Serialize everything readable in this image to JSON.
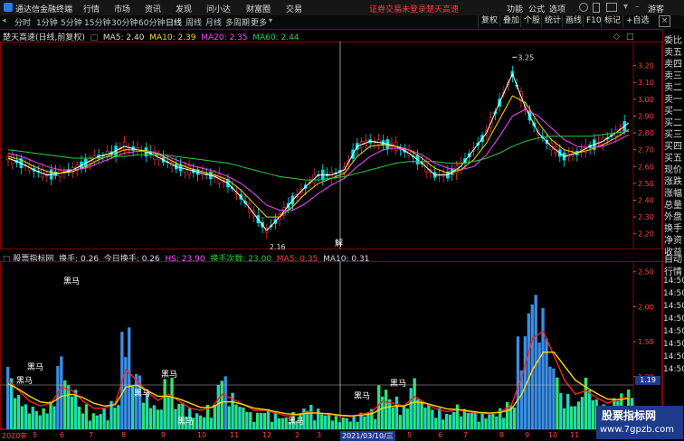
{
  "app": {
    "brand": "通达信金融终端",
    "menu": [
      "行情",
      "市场",
      "资讯",
      "发现",
      "问小达",
      "财富圈",
      "交易"
    ],
    "promo": "证券交易未登录",
    "stock_short": "楚天高速",
    "right_menu": [
      "功能",
      "公式",
      "选项"
    ],
    "guest": "游客"
  },
  "toolbar": {
    "periods": [
      "分时",
      "1分钟",
      "5分钟",
      "15分钟",
      "30分钟",
      "60分钟",
      "日线",
      "周线",
      "月线",
      "多周期",
      "更多"
    ],
    "active_period": "日线",
    "buttons": [
      "复权",
      "叠加",
      "个股",
      "统计",
      "画线",
      "F10",
      "标记",
      "+自选"
    ]
  },
  "main_chart": {
    "title": "楚天高速(日线,前复权)",
    "ma5": "MA5: 2.40",
    "ma10": "MA10: 2.39",
    "ma20": "MA20: 2.35",
    "ma60": "MA60: 2.44",
    "high_mark": "3.25",
    "low_mark": "2.16",
    "cursor_label": "解"
  },
  "sub_chart": {
    "title": "股票指标网",
    "turnover": "换手: 0.26",
    "today_turnover": "今日换手: 0.26",
    "hs": "HS: 23.90",
    "turnover_count": "换手次数: 23.00",
    "ma5": "MA5: 0.35",
    "ma10": "MA10: 0.31",
    "marker": "黑马",
    "cursor_value": "1.19"
  },
  "right_panel": {
    "items": [
      "委比",
      "卖五",
      "卖四",
      "卖三",
      "卖二",
      "卖一",
      "买一",
      "买二",
      "买三",
      "买四",
      "买五",
      "现价",
      "涨跌",
      "涨幅",
      "总量",
      "外盘",
      "换手",
      "净资",
      "收益"
    ],
    "lower": [
      "自动",
      "行情",
      "14:50",
      "14:50",
      "14:50",
      "14:50",
      "14:50",
      "14:50",
      "14:50",
      "14:50"
    ]
  },
  "watermark": {
    "line1": "股票指标网",
    "line2": "www.7gpzb.com"
  },
  "date_axis": {
    "start": "2020年",
    "ticks": [
      "5",
      "6",
      "7",
      "8",
      "9",
      "10",
      "11",
      "12",
      "2",
      "3"
    ],
    "cursor_date": "2021/03/10/三",
    "ticks_after": [
      "5",
      "6",
      "7",
      "8",
      "9",
      "10",
      "11"
    ]
  },
  "chart_data": [
    {
      "type": "line",
      "title": "楚天高速(日线,前复权)",
      "ylim": [
        2.15,
        3.3
      ],
      "yticks": [
        "3.20",
        "3.10",
        "3.00",
        "2.90",
        "2.80",
        "2.70",
        "2.60",
        "2.50",
        "2.40",
        "2.30",
        "2.20"
      ],
      "series": [
        {
          "name": "MA5",
          "color": "#ffffff",
          "values": [
            2.65,
            2.62,
            2.58,
            2.55,
            2.56,
            2.58,
            2.62,
            2.66,
            2.68,
            2.72,
            2.7,
            2.68,
            2.64,
            2.6,
            2.58,
            2.56,
            2.54,
            2.5,
            2.42,
            2.32,
            2.22,
            2.3,
            2.4,
            2.48,
            2.55,
            2.55,
            2.58,
            2.72,
            2.75,
            2.74,
            2.72,
            2.68,
            2.62,
            2.55,
            2.55,
            2.6,
            2.7,
            2.8,
            2.98,
            3.15,
            2.95,
            2.8,
            2.72,
            2.66,
            2.68,
            2.72,
            2.75,
            2.8,
            2.86
          ]
        },
        {
          "name": "MA10",
          "color": "#ffd700",
          "values": [
            2.66,
            2.64,
            2.6,
            2.57,
            2.56,
            2.57,
            2.6,
            2.64,
            2.67,
            2.7,
            2.7,
            2.69,
            2.66,
            2.62,
            2.59,
            2.57,
            2.55,
            2.52,
            2.46,
            2.38,
            2.3,
            2.3,
            2.36,
            2.44,
            2.5,
            2.53,
            2.56,
            2.66,
            2.72,
            2.73,
            2.72,
            2.7,
            2.65,
            2.59,
            2.56,
            2.58,
            2.64,
            2.74,
            2.88,
            3.02,
            2.98,
            2.86,
            2.76,
            2.7,
            2.68,
            2.7,
            2.73,
            2.77,
            2.82
          ]
        },
        {
          "name": "MA20",
          "color": "#ff44ff",
          "values": [
            2.68,
            2.66,
            2.63,
            2.6,
            2.58,
            2.58,
            2.59,
            2.62,
            2.65,
            2.68,
            2.69,
            2.69,
            2.67,
            2.64,
            2.61,
            2.59,
            2.57,
            2.54,
            2.5,
            2.44,
            2.37,
            2.34,
            2.34,
            2.38,
            2.44,
            2.49,
            2.53,
            2.6,
            2.66,
            2.7,
            2.71,
            2.7,
            2.67,
            2.62,
            2.59,
            2.58,
            2.6,
            2.67,
            2.78,
            2.9,
            2.94,
            2.9,
            2.83,
            2.76,
            2.72,
            2.71,
            2.72,
            2.75,
            2.79
          ]
        },
        {
          "name": "MA60",
          "color": "#2ecc40",
          "values": [
            2.7,
            2.69,
            2.68,
            2.67,
            2.66,
            2.65,
            2.65,
            2.65,
            2.66,
            2.66,
            2.67,
            2.67,
            2.67,
            2.66,
            2.65,
            2.64,
            2.63,
            2.62,
            2.6,
            2.58,
            2.56,
            2.54,
            2.53,
            2.52,
            2.52,
            2.53,
            2.54,
            2.56,
            2.58,
            2.6,
            2.62,
            2.63,
            2.63,
            2.63,
            2.62,
            2.62,
            2.63,
            2.65,
            2.68,
            2.72,
            2.75,
            2.77,
            2.78,
            2.78,
            2.78,
            2.78,
            2.79,
            2.8,
            2.81
          ]
        }
      ]
    },
    {
      "type": "bar",
      "title": "股票指标网",
      "ylim": [
        0.3,
        2.6
      ],
      "yticks": [
        "2.50",
        "2.00",
        "1.50",
        "1.00",
        "0.50"
      ],
      "values": [
        1.05,
        0.7,
        0.55,
        0.5,
        0.6,
        1.2,
        0.8,
        0.55,
        0.45,
        0.5,
        0.6,
        1.55,
        1.0,
        0.7,
        0.55,
        0.9,
        0.6,
        0.5,
        0.45,
        0.55,
        0.95,
        0.7,
        0.55,
        0.45,
        0.5,
        0.45,
        0.4,
        0.45,
        0.55,
        0.5,
        0.45,
        0.4,
        0.4,
        0.45,
        0.5,
        0.8,
        0.65,
        0.55,
        0.9,
        0.6,
        0.5,
        0.45,
        0.55,
        0.5,
        0.45,
        0.45,
        0.5,
        0.6,
        1.45,
        2.05,
        1.8,
        1.1,
        0.7,
        0.6,
        0.9,
        0.65,
        0.55,
        0.7,
        0.75
      ],
      "series": [
        {
          "name": "MA5",
          "color": "#ff2020",
          "values": [
            0.95,
            0.8,
            0.65,
            0.58,
            0.62,
            0.85,
            0.8,
            0.65,
            0.55,
            0.55,
            0.62,
            1.1,
            0.95,
            0.78,
            0.66,
            0.75,
            0.65,
            0.55,
            0.52,
            0.56,
            0.75,
            0.68,
            0.6,
            0.52,
            0.52,
            0.48,
            0.44,
            0.45,
            0.5,
            0.48,
            0.46,
            0.44,
            0.43,
            0.46,
            0.5,
            0.65,
            0.62,
            0.58,
            0.72,
            0.62,
            0.54,
            0.5,
            0.53,
            0.5,
            0.48,
            0.47,
            0.5,
            0.58,
            1.0,
            1.55,
            1.65,
            1.3,
            0.95,
            0.75,
            0.8,
            0.7,
            0.62,
            0.68,
            0.7
          ]
        },
        {
          "name": "MA10",
          "color": "#ffd700",
          "values": [
            0.9,
            0.82,
            0.72,
            0.64,
            0.62,
            0.72,
            0.75,
            0.7,
            0.62,
            0.58,
            0.6,
            0.85,
            0.88,
            0.8,
            0.72,
            0.72,
            0.68,
            0.62,
            0.56,
            0.56,
            0.64,
            0.64,
            0.6,
            0.55,
            0.53,
            0.5,
            0.47,
            0.46,
            0.48,
            0.48,
            0.47,
            0.45,
            0.44,
            0.45,
            0.47,
            0.55,
            0.58,
            0.58,
            0.64,
            0.62,
            0.58,
            0.54,
            0.53,
            0.51,
            0.49,
            0.48,
            0.49,
            0.53,
            0.75,
            1.1,
            1.35,
            1.35,
            1.15,
            0.95,
            0.85,
            0.76,
            0.68,
            0.67,
            0.69
          ]
        }
      ]
    }
  ]
}
